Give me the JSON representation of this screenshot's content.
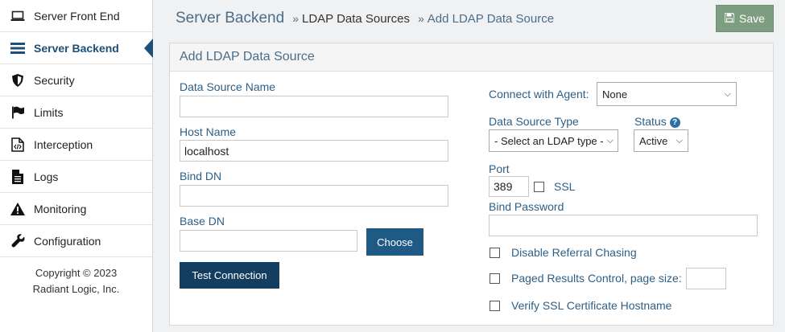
{
  "sidebar": {
    "items": [
      {
        "label": "Server Front End",
        "icon": "laptop-icon"
      },
      {
        "label": "Server Backend",
        "icon": "server-icon",
        "active": true
      },
      {
        "label": "Security",
        "icon": "shield-icon"
      },
      {
        "label": "Limits",
        "icon": "flag-icon"
      },
      {
        "label": "Interception",
        "icon": "code-file-icon"
      },
      {
        "label": "Logs",
        "icon": "document-icon"
      },
      {
        "label": "Monitoring",
        "icon": "warning-icon"
      },
      {
        "label": "Configuration",
        "icon": "wrench-icon"
      }
    ],
    "copyright_line1": "Copyright © 2023",
    "copyright_line2": "Radiant Logic, Inc."
  },
  "breadcrumb": {
    "root": "Server Backend",
    "sep": "»",
    "mid": "LDAP Data Sources",
    "last": "Add LDAP Data Source"
  },
  "toolbar": {
    "save_label": "Save"
  },
  "panel": {
    "title": "Add LDAP Data Source",
    "data_source_name_label": "Data Source Name",
    "data_source_name_value": "",
    "host_name_label": "Host Name",
    "host_name_value": "localhost",
    "bind_dn_label": "Bind DN",
    "bind_dn_value": "",
    "base_dn_label": "Base DN",
    "base_dn_value": "",
    "choose_label": "Choose",
    "test_connection_label": "Test Connection",
    "connect_agent_label": "Connect with Agent:",
    "connect_agent_value": "None",
    "ds_type_label": "Data Source Type",
    "ds_type_value": "- Select an LDAP type -",
    "status_label": "Status",
    "status_value": "Active",
    "port_label": "Port",
    "port_value": "389",
    "ssl_label": "SSL",
    "bind_password_label": "Bind Password",
    "bind_password_value": "",
    "disable_referral_label": "Disable Referral Chasing",
    "paged_results_label": "Paged Results Control, page size:",
    "paged_results_value": "",
    "verify_ssl_label": "Verify SSL Certificate Hostname"
  },
  "colors": {
    "accent": "#1d4f78",
    "label": "#2d5f86",
    "save": "#7d9e80",
    "button": "#1f5a85",
    "test_button": "#133e5f"
  }
}
